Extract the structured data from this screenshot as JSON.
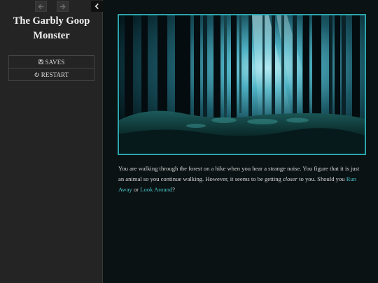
{
  "sidebar": {
    "title": "The Garbly Goop Monster",
    "menu": {
      "saves_label": "SAVES",
      "restart_label": "RESTART"
    }
  },
  "icons": {
    "back": "arrow-left-icon",
    "forward": "arrow-right-icon",
    "collapse": "chevron-left-icon",
    "saves": "floppy-disk-icon",
    "restart": "power-icon"
  },
  "main": {
    "passage": {
      "part1": "You are walking through the forest on a hike when you hear a strange noise. You figure that it is just an animal so you continue walking. However, it seems to be getting ",
      "emphasis": "closer",
      "part2": " to you. Should you ",
      "link1": "Run Away",
      "part3": " or ",
      "link2": "Look Around",
      "part4": "?"
    }
  },
  "colors": {
    "page_background": "#0b1213",
    "sidebar_background": "#242424",
    "accent": "#2ba6ac",
    "link": "#45c1c8"
  }
}
